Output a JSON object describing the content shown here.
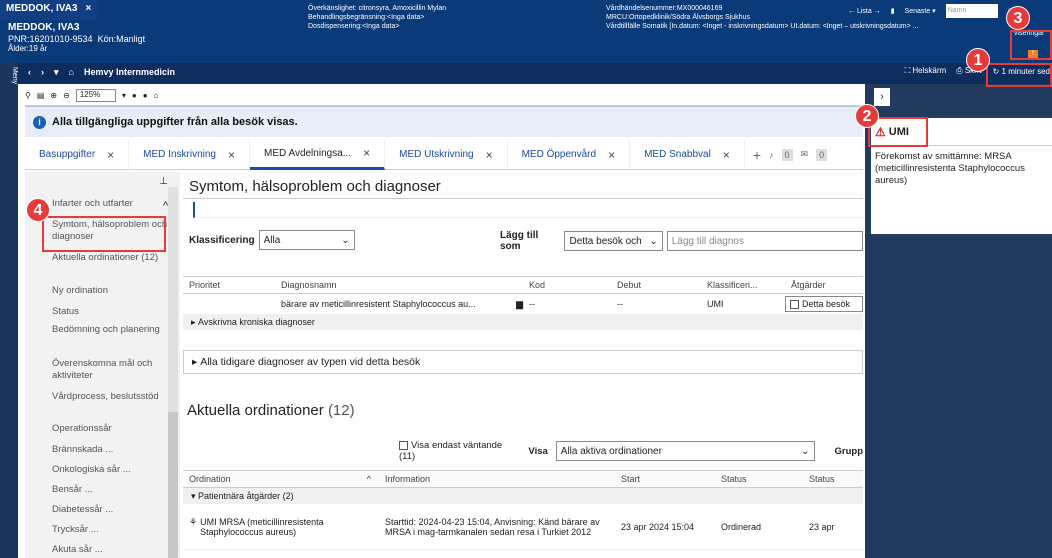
{
  "header": {
    "patient_tab": "MEDDOK, IVA3",
    "patient_name": "MEDDOK, IVA3",
    "pnr": "PNR:16201010-9534",
    "gender": "Kön:Manligt",
    "age": "Ålder:19 år",
    "mid_lines": [
      "Överkänslighet: citronsyra, Amoxicillin Mylan",
      "Behandlingsbegränsning:<Inga data>",
      "Dosdispensering:<Inga data>"
    ],
    "right_lines": [
      "Vårdhändelsenummer:MX000046169",
      "MRCU:Ortopedklinik/Södra Älvsborgs Sjukhus",
      "Vårdtillfälle Somatik [In.datum: <Inget - inskrivningsdatum> Ut.datum: <Inget – utskrivningsdatum> ..."
    ],
    "lista": "← Lista →",
    "senaste": "Senaste ▾",
    "search_placeholder": "Namn",
    "viseringar": "viseringar"
  },
  "nav": {
    "menu": "Meny",
    "back": "‹",
    "forward": "›",
    "home_label": "Hemvy Internmedicin",
    "helskarm": "Helskärm",
    "skriv": "Skriv",
    "refresh": "1 minuter sed"
  },
  "toolbar": {
    "zoom": "125%"
  },
  "info_text": "Alla tillgängliga uppgifter från alla besök visas.",
  "tabs": [
    "Basuppgifter",
    "MED Inskrivning",
    "MED Avdelningsa...",
    "MED Utskrivning",
    "MED Öppenvård",
    "MED Snabbval"
  ],
  "tab_counts": [
    "0",
    "0"
  ],
  "sidebar": {
    "items": [
      "Infarter och utfarter",
      "Symtom, hälsoproblem och diagnoser",
      "Aktuella ordinationer (12)",
      "Ny ordination",
      "Status",
      "Bedömning och planering",
      "Överenskomna mål och aktiviteter",
      "Vårdprocess, beslutsstöd",
      "Operationssår",
      "Brännskada ...",
      "Onkologiska sår ...",
      "Bensår ...",
      "Diabetessår ...",
      "Trycksår ...",
      "Akuta sår ..."
    ]
  },
  "main": {
    "title": "Symtom, hälsoproblem och diagnoser",
    "klass_label": "Klassificering",
    "klass_value": "Alla",
    "lagg_label": "Lägg till som",
    "lagg_value": "Detta besök och",
    "lagg_placeholder": "Lägg till diagnos",
    "diag_headers": [
      "Prioritet",
      "Diagnosnamn",
      "Kod",
      "Debut",
      "Klassificeri...",
      "Åtgärder"
    ],
    "diag_row": [
      "",
      "bärare av meticillinresistent Staphylococcus au...",
      "--",
      "--",
      "UMI",
      "Detta besök"
    ],
    "avskrivna": "Avskrivna kroniska diagnoser",
    "alla_tidigare": "Alla tidigare diagnoser av typen vid detta besök",
    "ord_title": "Aktuella ordinationer",
    "ord_count": "(12)",
    "visa_endast": "Visa endast väntande (11)",
    "visa_label": "Visa",
    "visa_value": "Alla aktiva ordinationer",
    "grupp": "Grupp",
    "ord_headers": [
      "Ordination",
      "Information",
      "Start",
      "Status",
      "Status"
    ],
    "group_row": "Patientnära åtgärder (2)",
    "ord_row": [
      "UMI MRSA (meticillinresistenta Staphylococcus aureus)",
      "Starttid: 2024-04-23 15:04, Anvisning: Känd bärare av MRSA i mag-tarmkanalen sedan resa i Turkiet 2012",
      "23 apr 2024 15:04",
      "Ordinerad",
      "23 apr"
    ]
  },
  "rpanel": {
    "umi_title": "UMI",
    "desc": "Förekomst av smittämne: MRSA (meticillinresistenta Staphylococcus aureus)"
  },
  "badges": [
    "1",
    "2",
    "3",
    "4"
  ],
  "colors": {
    "accent": "#e53b3b",
    "header": "#0b3a78",
    "panel": "#223a5e"
  }
}
